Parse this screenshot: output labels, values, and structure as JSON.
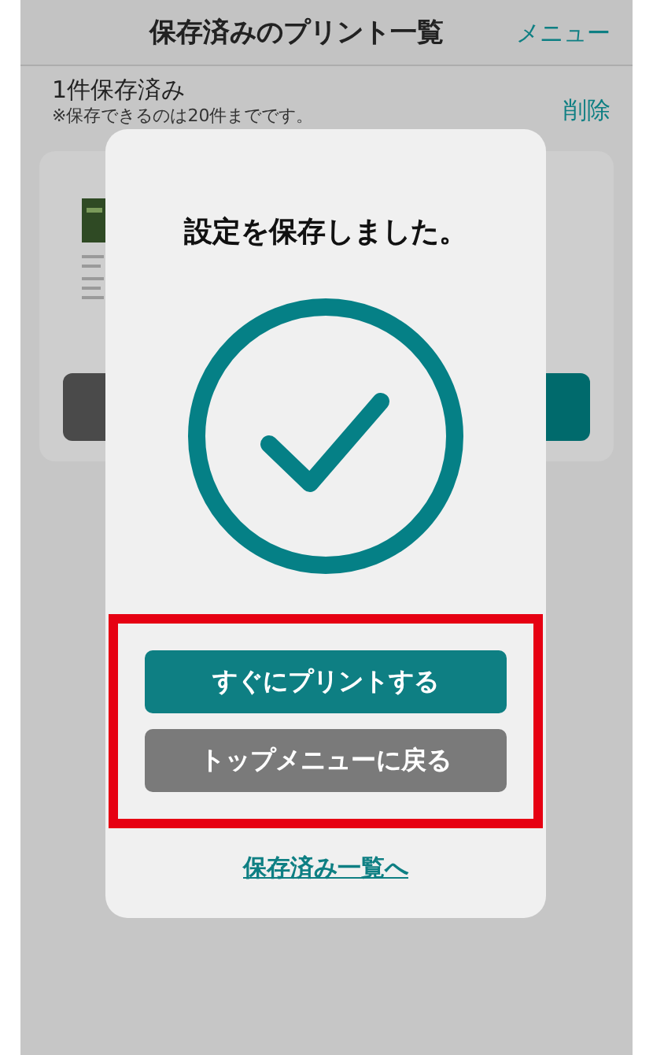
{
  "header": {
    "title": "保存済みのプリント一覧",
    "menu": "メニュー"
  },
  "summary": {
    "count": "1件保存済み",
    "note": "※保存できるのは20件までです。",
    "delete": "削除"
  },
  "dialog": {
    "message": "設定を保存しました。",
    "actions": {
      "highlighted": true,
      "buttons": [
        {
          "kind": "primary",
          "label": "すぐにプリントする"
        },
        {
          "kind": "secondary",
          "label": "トップメニューに戻る"
        }
      ]
    },
    "link": "保存済み一覧へ"
  }
}
